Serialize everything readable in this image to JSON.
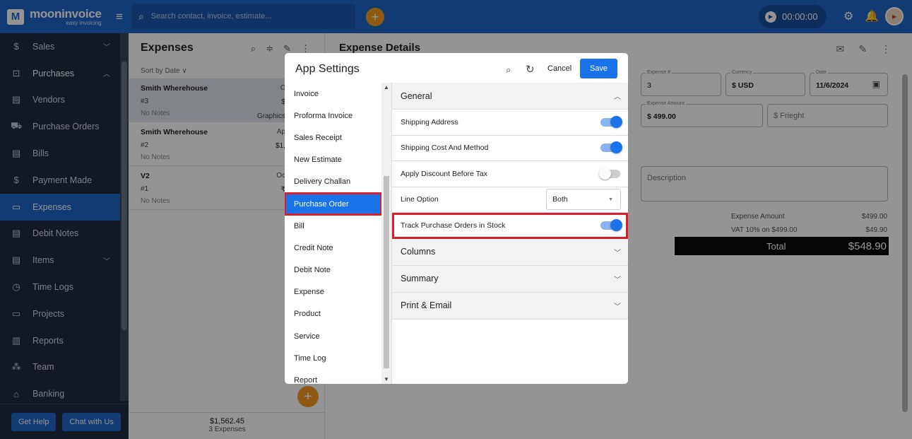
{
  "app": {
    "logo_name": "mooninvoice",
    "logo_tag": "easy invoicing",
    "logo_mark": "M"
  },
  "topbar": {
    "search_placeholder": "Search contact, invoice, estimate...",
    "timer": "00:00:00"
  },
  "sidebar": {
    "items": [
      {
        "label": "Sales",
        "icon": "dollar-icon",
        "glyph": "$",
        "chevron": "﹀"
      },
      {
        "label": "Purchases",
        "icon": "bag-icon",
        "glyph": "⊡",
        "chevron": "︿"
      },
      {
        "label": "Vendors",
        "icon": "vendor-icon",
        "glyph": "▤",
        "chevron": ""
      },
      {
        "label": "Purchase Orders",
        "icon": "cart-icon",
        "glyph": "⛟",
        "chevron": ""
      },
      {
        "label": "Bills",
        "icon": "bill-icon",
        "glyph": "▤",
        "chevron": ""
      },
      {
        "label": "Payment Made",
        "icon": "payment-icon",
        "glyph": "$",
        "chevron": ""
      },
      {
        "label": "Expenses",
        "icon": "wallet-icon",
        "glyph": "▭",
        "chevron": ""
      },
      {
        "label": "Debit Notes",
        "icon": "note-icon",
        "glyph": "▤",
        "chevron": ""
      },
      {
        "label": "Items",
        "icon": "items-icon",
        "glyph": "▤",
        "chevron": "﹀"
      },
      {
        "label": "Time Logs",
        "icon": "clock-icon",
        "glyph": "◷",
        "chevron": ""
      },
      {
        "label": "Projects",
        "icon": "folder-icon",
        "glyph": "▭",
        "chevron": ""
      },
      {
        "label": "Reports",
        "icon": "chart-icon",
        "glyph": "▥",
        "chevron": ""
      },
      {
        "label": "Team",
        "icon": "team-icon",
        "glyph": "⁂",
        "chevron": ""
      },
      {
        "label": "Banking",
        "icon": "bank-icon",
        "glyph": "⌂",
        "chevron": ""
      }
    ],
    "get_help": "Get Help",
    "chat": "Chat with Us"
  },
  "list": {
    "title": "Expenses",
    "sort": "Sort by Date ∨",
    "rows": [
      {
        "name": "Smith Wherehouse",
        "num": "#3",
        "notes": "No Notes",
        "right_top": "C",
        "right_amt": "$",
        "right_cat": "Graphics"
      },
      {
        "name": "Smith Wherehouse",
        "num": "#2",
        "notes": "No Notes",
        "right_top": "Ap",
        "right_amt": "$1,",
        "right_cat": ""
      },
      {
        "name": "V2",
        "num": "#1",
        "notes": "No Notes",
        "right_top": "Oc",
        "right_amt": "₹",
        "right_cat": ""
      }
    ],
    "footer_total": "$1,562.45",
    "footer_count": "3 Expenses"
  },
  "details": {
    "title": "Expense Details",
    "expense_no_label": "Expense #",
    "expense_no": "3",
    "currency_label": "Currency",
    "currency": "$ USD",
    "date_label": "Date",
    "date": "11/6/2024",
    "amount_label": "Expense Amount",
    "amount": "$ 499.00",
    "freight_placeholder": "$ Frieght",
    "description_placeholder": "Description",
    "summary": [
      {
        "label": "Expense Amount",
        "value": "$499.00"
      },
      {
        "label": "VAT 10% on $499.00",
        "value": "$49.90"
      }
    ],
    "total_label": "Total",
    "total_value": "$548.90"
  },
  "modal": {
    "title": "App Settings",
    "cancel": "Cancel",
    "save": "Save",
    "menu": [
      "Invoice",
      "Proforma Invoice",
      "Sales Receipt",
      "New Estimate",
      "Delivery Challan",
      "Purchase Order",
      "Bill",
      "Credit Note",
      "Debit Note",
      "Expense",
      "Product",
      "Service",
      "Time Log",
      "Report"
    ],
    "active_menu": "Purchase Order",
    "general": "General",
    "rows": {
      "shipping_address": "Shipping Address",
      "shipping_cost": "Shipping Cost And Method",
      "apply_discount": "Apply Discount Before Tax",
      "line_option": "Line Option",
      "line_option_value": "Both",
      "track_po": "Track Purchase Orders in Stock"
    },
    "toggles": {
      "shipping_address": true,
      "shipping_cost": true,
      "apply_discount": false,
      "track_po": true
    },
    "sections": [
      "Columns",
      "Summary",
      "Print & Email"
    ]
  },
  "colors": {
    "primary": "#1f67c9",
    "accent": "#f59a1f",
    "sidebar_bg": "#1f2b3e",
    "highlight": "#d8202f"
  }
}
